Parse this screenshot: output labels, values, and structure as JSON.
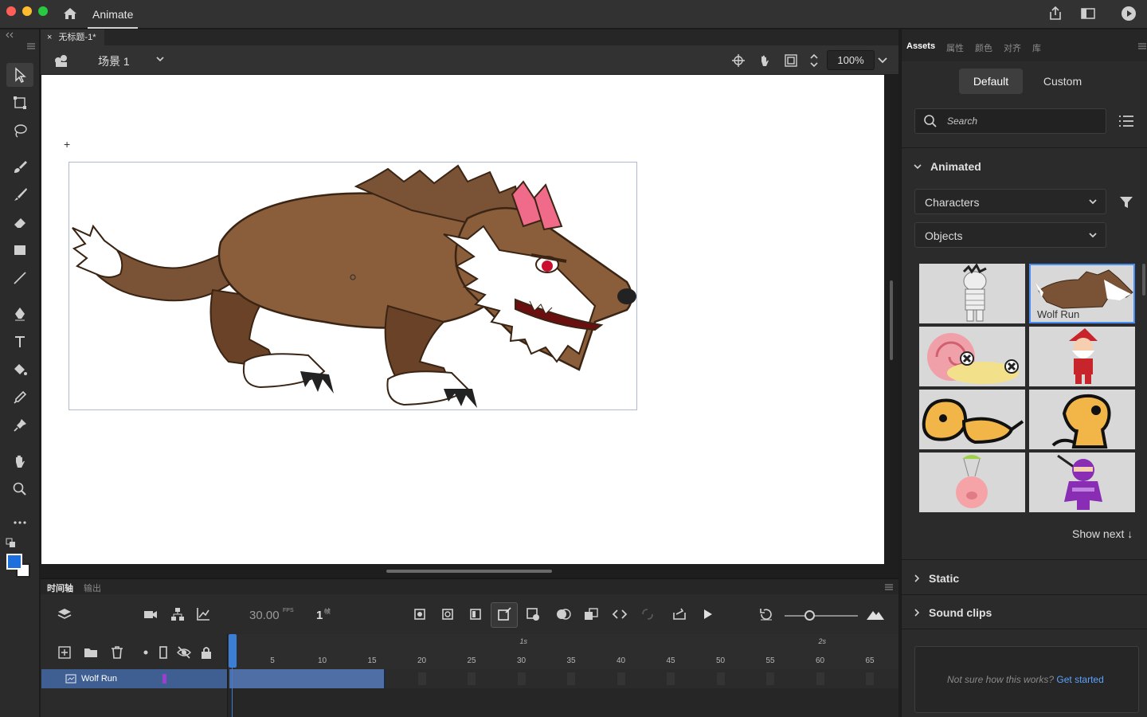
{
  "titlebar": {
    "app_name": "Animate"
  },
  "document": {
    "tab_title": "无标题-1*",
    "scene_name": "场景 1",
    "zoom": "100%"
  },
  "timeline": {
    "tabs": [
      "时间轴",
      "输出"
    ],
    "fps": "30.00",
    "fps_unit": "FPS",
    "current_frame": "1",
    "frame_unit": "帧",
    "ruler_numbers": [
      "5",
      "10",
      "15",
      "20",
      "25",
      "30",
      "35",
      "40",
      "45",
      "50",
      "55",
      "60",
      "65"
    ],
    "ruler_seconds": [
      "1s",
      "2s"
    ],
    "layers": [
      {
        "name": "Wolf Run",
        "color": "#9b3fd1"
      }
    ]
  },
  "assets": {
    "tabs": [
      "Assets",
      "属性",
      "颜色",
      "对齐",
      "库"
    ],
    "segments": {
      "default": "Default",
      "custom": "Custom"
    },
    "search_placeholder": "Search",
    "sections": {
      "animated": "Animated",
      "static": "Static",
      "sound_clips": "Sound clips"
    },
    "filters": {
      "category": "Characters",
      "subcategory": "Objects"
    },
    "thumbnails": [
      {
        "label": "",
        "name": "mummy"
      },
      {
        "label": "Wolf Run",
        "name": "wolf"
      },
      {
        "label": "",
        "name": "snail"
      },
      {
        "label": "",
        "name": "santa"
      },
      {
        "label": "",
        "name": "dog-lying"
      },
      {
        "label": "",
        "name": "dog-sitting"
      },
      {
        "label": "",
        "name": "pig-parachute"
      },
      {
        "label": "",
        "name": "ninja"
      }
    ],
    "show_next": "Show next ↓",
    "help_text": "Not sure how this works?",
    "help_link": "Get started"
  },
  "colors": {
    "accent": "#4a8ef5",
    "layer_row": "#3f5f93",
    "fill": "#1c6fdc"
  }
}
